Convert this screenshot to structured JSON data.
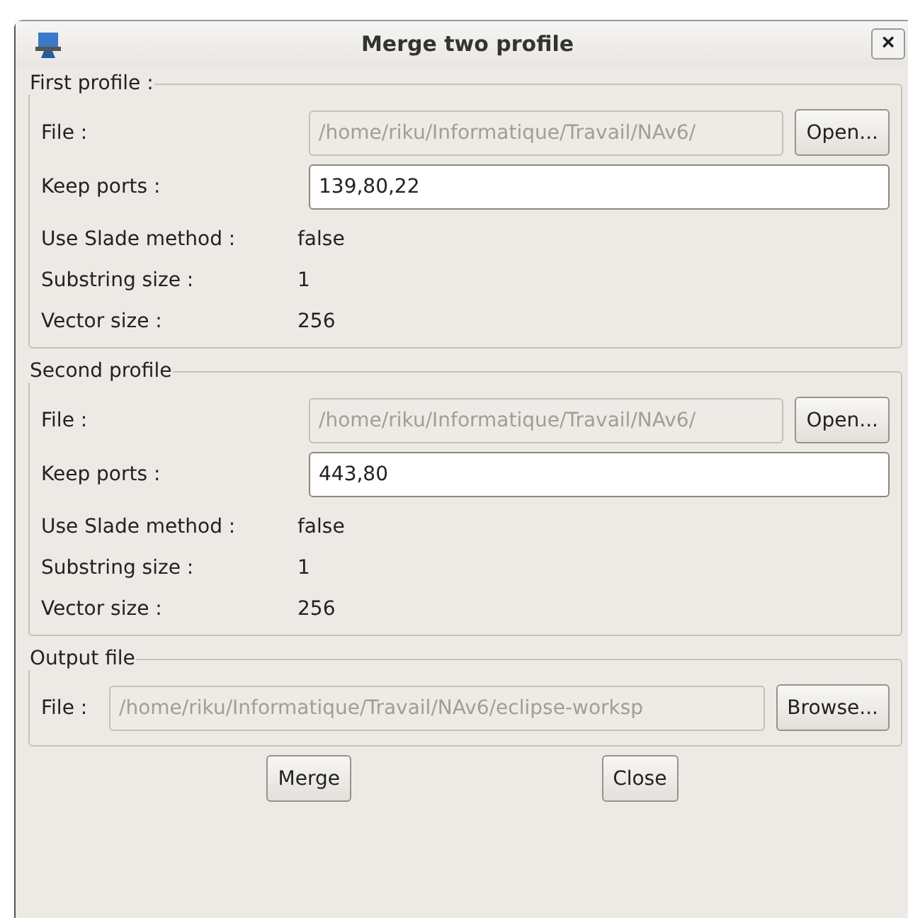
{
  "window": {
    "title": "Merge two profile",
    "close": "×"
  },
  "profiles": [
    {
      "legend": "First profile :",
      "file_label": "File :",
      "file": {
        "value": "/home/riku/Informatique/Travail/NAv6/",
        "disabled": true
      },
      "open_button": "Open...",
      "ports_label": "Keep ports :",
      "ports": {
        "value": "139,80,22",
        "disabled": false
      },
      "info": [
        {
          "label": "Use Slade method :",
          "value": "false"
        },
        {
          "label": "Substring size :",
          "value": "1"
        },
        {
          "label": "Vector size :",
          "value": "256"
        }
      ]
    },
    {
      "legend": "Second profile",
      "file_label": "File :",
      "file": {
        "value": "/home/riku/Informatique/Travail/NAv6/",
        "disabled": true
      },
      "open_button": "Open...",
      "ports_label": "Keep ports :",
      "ports": {
        "value": "443,80",
        "disabled": false
      },
      "info": [
        {
          "label": "Use Slade method :",
          "value": "false"
        },
        {
          "label": "Substring size :",
          "value": "1"
        },
        {
          "label": "Vector size :",
          "value": "256"
        }
      ]
    }
  ],
  "output": {
    "legend": "Output file",
    "file_label": "File :",
    "file": {
      "value": "/home/riku/Informatique/Travail/NAv6/eclipse-worksp",
      "disabled": true
    },
    "browse_button": "Browse..."
  },
  "buttons": [
    "Merge",
    "Close"
  ]
}
